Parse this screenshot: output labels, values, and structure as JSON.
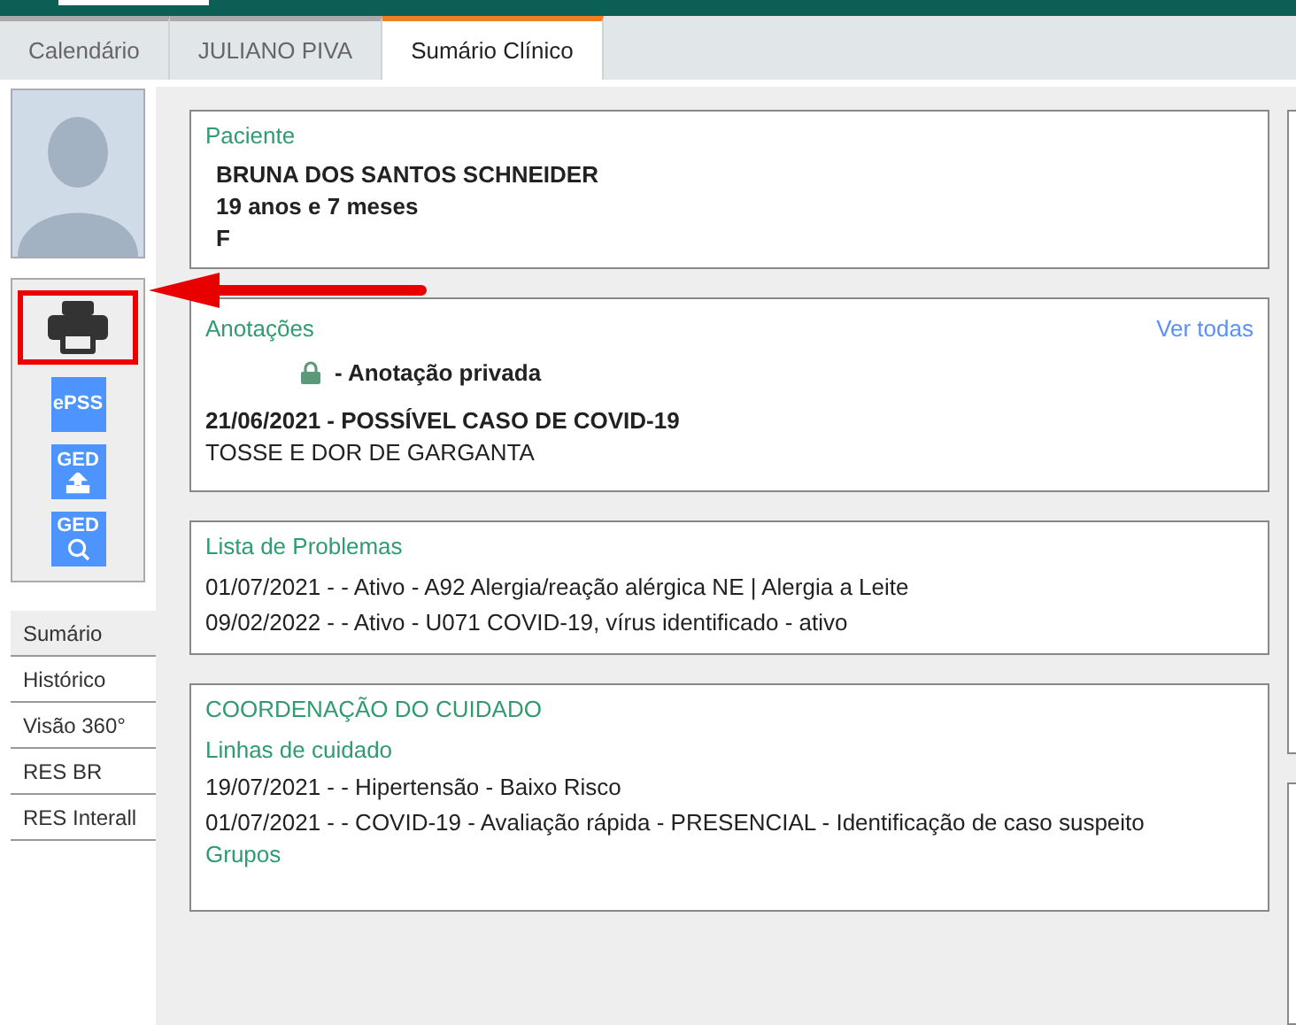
{
  "tabs": [
    {
      "label": "Calendário",
      "selected": false
    },
    {
      "label": "JULIANO PIVA",
      "selected": false
    },
    {
      "label": "Sumário Clínico",
      "selected": true
    }
  ],
  "tools": [
    {
      "kind": "printer",
      "highlighted": true
    },
    {
      "kind": "epss",
      "label": "ePSS",
      "highlighted": false
    },
    {
      "kind": "ged_upload",
      "label": "GED",
      "highlighted": false
    },
    {
      "kind": "ged_search",
      "label": "GED",
      "highlighted": false
    }
  ],
  "nav": [
    {
      "label": "Sumário",
      "selected": true
    },
    {
      "label": "Histórico",
      "selected": false
    },
    {
      "label": "Visão 360°",
      "selected": false
    },
    {
      "label": "RES BR",
      "selected": false
    },
    {
      "label": "RES Interall",
      "selected": false
    }
  ],
  "patient": {
    "title": "Paciente",
    "lines": [
      "BRUNA DOS SANTOS SCHNEIDER",
      "19 anos e 7 meses",
      "F"
    ]
  },
  "notes": {
    "title": "Anotações",
    "link": "Ver todas",
    "privacy": "-  Anotação privada",
    "heading": "21/06/2021  -  POSSÍVEL CASO DE COVID-19",
    "text": "TOSSE E DOR DE GARGANTA"
  },
  "problems": {
    "title": "Lista de Problemas",
    "items": [
      "01/07/2021 - - Ativo - A92 Alergia/reação alérgica NE | Alergia a Leite",
      "09/02/2022 - - Ativo - U071 COVID-19, vírus identificado - ativo"
    ]
  },
  "care": {
    "title": "COORDENAÇÃO DO CUIDADO",
    "sections": [
      {
        "title": "Linhas de cuidado",
        "items": [
          "19/07/2021 - - Hipertensão - Baixo Risco",
          "01/07/2021 - - COVID-19 - Avaliação rápida - PRESENCIAL - Identificação de caso suspeito"
        ]
      },
      {
        "title": "Grupos"
      }
    ]
  }
}
